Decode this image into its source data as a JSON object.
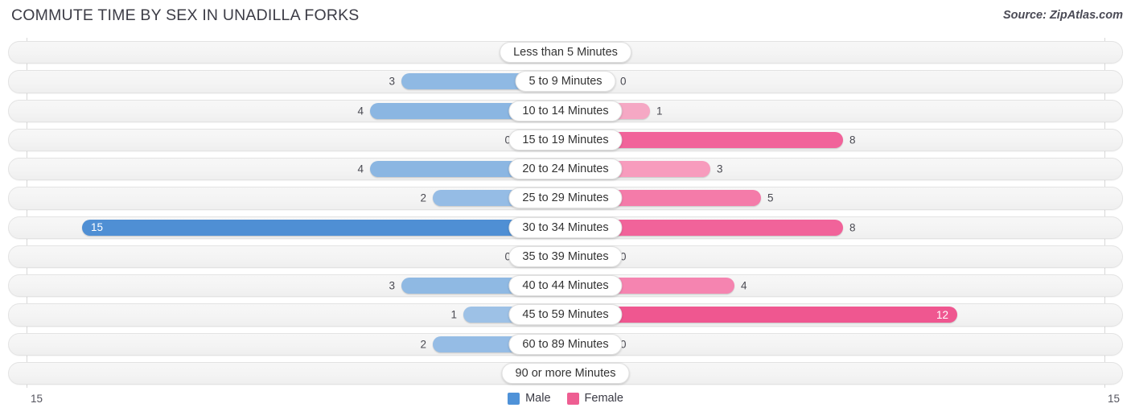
{
  "header": {
    "title": "COMMUTE TIME BY SEX IN UNADILLA FORKS",
    "source": "Source: ZipAtlas.com"
  },
  "legend": {
    "male_label": "Male",
    "female_label": "Female",
    "male_color": "#4f92d8",
    "female_color": "#ee5e92"
  },
  "axis": {
    "left_max": "15",
    "right_max": "15"
  },
  "chart_data": {
    "type": "bar",
    "orientation": "horizontal-diverging",
    "title": "COMMUTE TIME BY SEX IN UNADILLA FORKS",
    "xlabel": "",
    "ylabel": "",
    "xlim": [
      15,
      15
    ],
    "grid": true,
    "legend_position": "bottom-center",
    "categories": [
      "Less than 5 Minutes",
      "5 to 9 Minutes",
      "10 to 14 Minutes",
      "15 to 19 Minutes",
      "20 to 24 Minutes",
      "25 to 29 Minutes",
      "30 to 34 Minutes",
      "35 to 39 Minutes",
      "40 to 44 Minutes",
      "45 to 59 Minutes",
      "60 to 89 Minutes",
      "90 or more Minutes"
    ],
    "series": [
      {
        "name": "Male",
        "values": [
          0,
          3,
          4,
          0,
          4,
          2,
          15,
          0,
          3,
          1,
          2,
          0
        ]
      },
      {
        "name": "Female",
        "values": [
          0,
          0,
          1,
          8,
          3,
          5,
          8,
          0,
          4,
          12,
          0,
          0
        ]
      }
    ]
  },
  "rows": [
    {
      "label": "Less than 5 Minutes",
      "male": "0",
      "female": "0",
      "male_w": 60,
      "female_w": 60,
      "male_c": "#a8c8e8",
      "female_c": "#f6b5cd"
    },
    {
      "label": "5 to 9 Minutes",
      "male": "3",
      "female": "0",
      "male_w": 204,
      "female_w": 60,
      "male_c": "#8fb9e3",
      "female_c": "#f6b5cd"
    },
    {
      "label": "10 to 14 Minutes",
      "male": "4",
      "female": "1",
      "male_w": 243,
      "female_w": 105,
      "male_c": "#8bb6e2",
      "female_c": "#f5a8c4"
    },
    {
      "label": "15 to 19 Minutes",
      "male": "0",
      "female": "8",
      "male_w": 60,
      "female_w": 345,
      "male_c": "#a8c8e8",
      "female_c": "#f1639a"
    },
    {
      "label": "20 to 24 Minutes",
      "male": "4",
      "female": "3",
      "male_w": 243,
      "female_w": 180,
      "male_c": "#8bb6e2",
      "female_c": "#f79cbd"
    },
    {
      "label": "25 to 29 Minutes",
      "male": "2",
      "female": "5",
      "male_w": 165,
      "female_w": 243,
      "male_c": "#95bce5",
      "female_c": "#f47ba9"
    },
    {
      "label": "30 to 34 Minutes",
      "male": "15",
      "female": "8",
      "male_w": 601,
      "female_w": 345,
      "male_c": "#4f8fd4",
      "female_c": "#f1639a"
    },
    {
      "label": "35 to 39 Minutes",
      "male": "0",
      "female": "0",
      "male_w": 60,
      "female_w": 60,
      "male_c": "#a8c8e8",
      "female_c": "#f6b5cd"
    },
    {
      "label": "40 to 44 Minutes",
      "male": "3",
      "female": "4",
      "male_w": 204,
      "female_w": 210,
      "male_c": "#8fb9e3",
      "female_c": "#f584b0"
    },
    {
      "label": "45 to 59 Minutes",
      "male": "1",
      "female": "12",
      "male_w": 127,
      "female_w": 487,
      "male_c": "#9dc1e6",
      "female_c": "#ef5790"
    },
    {
      "label": "60 to 89 Minutes",
      "male": "2",
      "female": "0",
      "male_w": 165,
      "female_w": 60,
      "male_c": "#95bce5",
      "female_c": "#f6b5cd"
    },
    {
      "label": "90 or more Minutes",
      "male": "0",
      "female": "0",
      "male_w": 60,
      "female_w": 60,
      "male_c": "#a8c8e8",
      "female_c": "#f6b5cd"
    }
  ]
}
